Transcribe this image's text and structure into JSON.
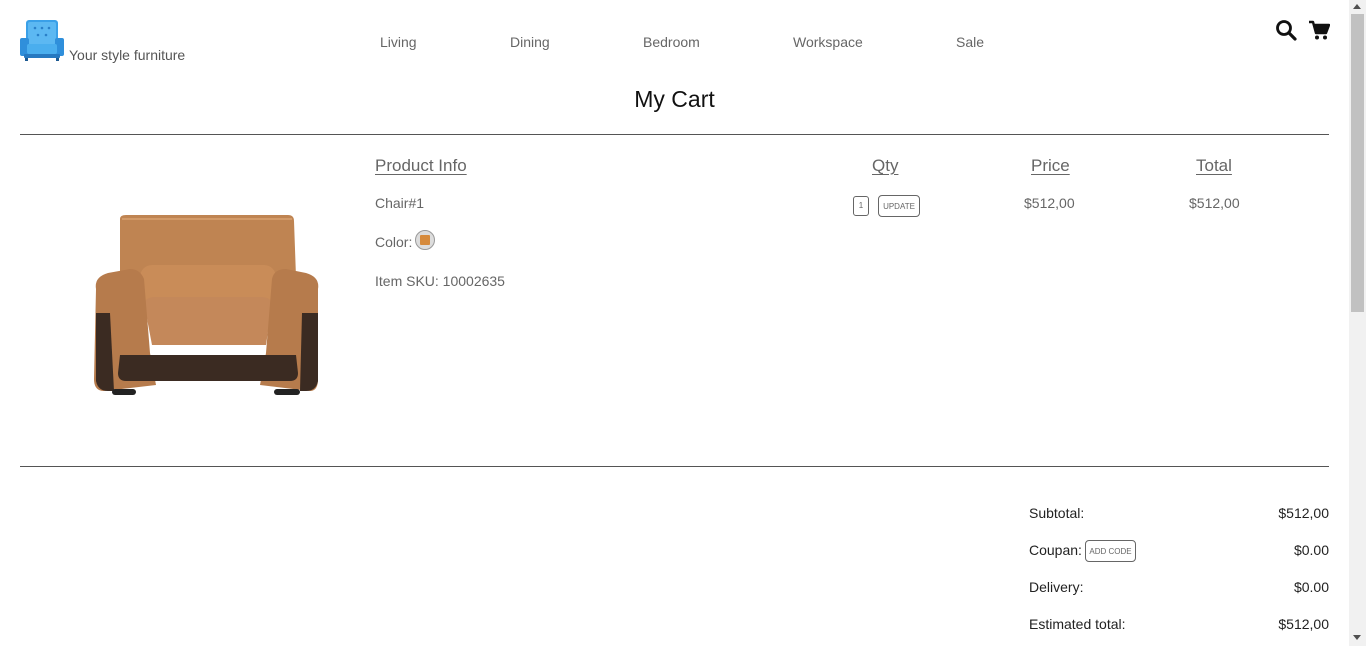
{
  "header": {
    "brand": "Your style furniture",
    "nav": [
      "Living",
      "Dining",
      "Bedroom",
      "Workspace",
      "Sale"
    ],
    "icons": [
      "search-icon",
      "cart-icon"
    ]
  },
  "page_title": "My Cart",
  "columns": {
    "product_info": "Product Info",
    "qty": "Qty",
    "price": "Price",
    "total": "Total"
  },
  "item": {
    "name": "Chair#1",
    "color_label": "Color:",
    "color_hex": "#d68a3c",
    "sku": "Item SKU: 10002635",
    "qty": "1",
    "update_label": "UPDATE",
    "price": "$512,00",
    "total": "$512,00"
  },
  "summary": {
    "subtotal_label": "Subtotal:",
    "subtotal": "$512,00",
    "coupon_label": "Coupan:",
    "add_code_label": "ADD CODE",
    "coupon": "$0.00",
    "delivery_label": "Delivery:",
    "delivery": "$0.00",
    "estimated_label": "Estimated total:",
    "estimated": "$512,00"
  }
}
